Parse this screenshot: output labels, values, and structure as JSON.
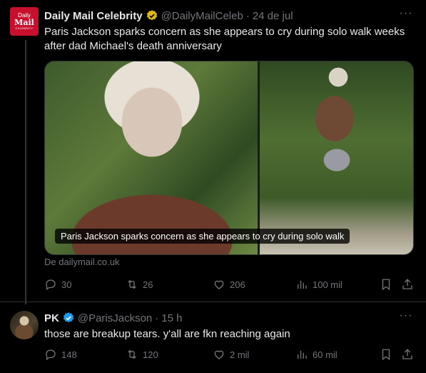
{
  "tweets": [
    {
      "author_name": "Daily Mail Celebrity",
      "handle": "@DailyMailCeleb",
      "separator": "·",
      "time": "24 de jul",
      "logo": {
        "line1": "Daily",
        "line2": "Mail",
        "line3": "CELEBRITY"
      },
      "text": "Paris Jackson sparks concern as she appears to cry during solo walk weeks after dad Michael's death anniversary",
      "media_caption": "Paris Jackson sparks concern as she appears to cry during solo walk",
      "source": "De dailymail.co.uk",
      "replies": "30",
      "reposts": "26",
      "likes": "206",
      "views": "100 mil",
      "more_icon": "more-icon",
      "verified_color": "#e2b719"
    },
    {
      "author_name": "PK",
      "handle": "@ParisJackson",
      "separator": "·",
      "time": "15 h",
      "text": "those are breakup tears. y'all are fkn reaching again",
      "replies": "148",
      "reposts": "120",
      "likes": "2 mil",
      "views": "60 mil",
      "more_icon": "more-icon",
      "verified_color": "#1d9bf0"
    }
  ],
  "colors": {
    "background": "#000000",
    "text": "#e7e9ea",
    "muted": "#71767b",
    "divider": "#2f3336",
    "logo_red": "#c8102e"
  }
}
